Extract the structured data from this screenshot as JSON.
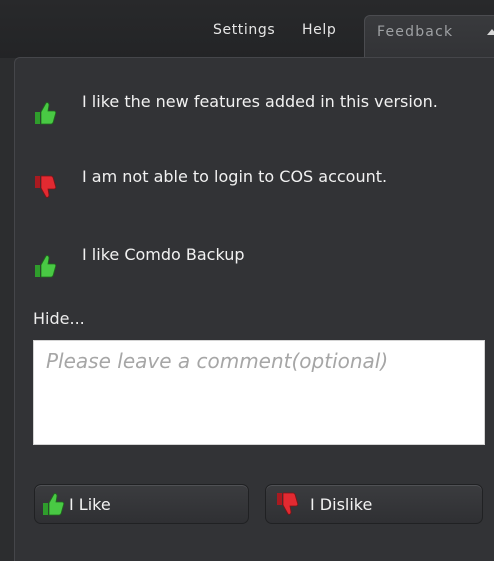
{
  "menu": {
    "settings_label": "Settings",
    "help_label": "Help",
    "feedback_tab_label": "Feedback"
  },
  "feedback_items": [
    {
      "type": "like",
      "icon": "thumbs-up-icon",
      "text": "I like the new features added in this version."
    },
    {
      "type": "dislike",
      "icon": "thumbs-down-icon",
      "text": "I am not able to login to COS account."
    },
    {
      "type": "like",
      "icon": "thumbs-up-icon",
      "text": "I like Comdo Backup"
    }
  ],
  "hide_label": "Hide...",
  "comment": {
    "placeholder": "Please leave a comment(optional)",
    "value": ""
  },
  "buttons": {
    "like_label": "I Like",
    "dislike_label": "I Dislike"
  },
  "colors": {
    "background": "#2c2d2f",
    "panel": "#323336",
    "like_green": "#3fbf3a",
    "dislike_red": "#d8232a"
  }
}
